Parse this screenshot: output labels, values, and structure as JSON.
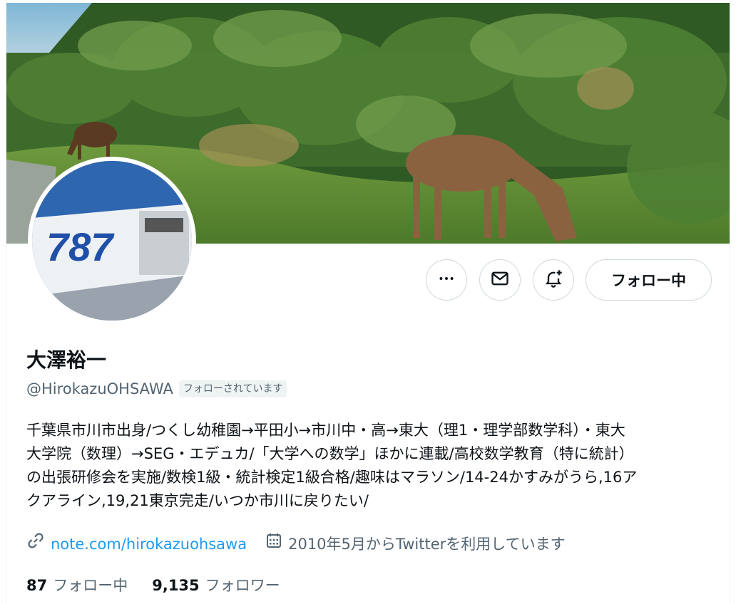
{
  "profile": {
    "display_name": "大澤裕一",
    "handle": "@HirokazuOHSAWA",
    "follows_you_badge": "フォローされています",
    "bio_lines": [
      "千葉県市川市出身/つくし幼稚園→平田小→市川中・高→東大（理1・理学部数学科）・東大",
      "大学院（数理）→SEG・エデュカ/「大学への数学」ほかに連載/高校数学教育（特に統計）",
      "の出張研修会を実施/数検1級・統計検定1級合格/趣味はマラソン/14-24かすみがうら,16ア",
      "クアライン,19,21東京完走/いつか市川に戻りたい/"
    ],
    "website": "note.com/hirokazuohsawa",
    "joined": "2010年5月からTwitterを利用しています",
    "following_count": "87",
    "following_label": "フォロー中",
    "followers_count": "9,135",
    "followers_label": "フォロワー",
    "avatar_text": "787"
  },
  "actions": {
    "more_icon": "more-horizontal-icon",
    "mail_icon": "envelope-icon",
    "notify_icon": "bell-plus-icon",
    "follow_label": "フォロー中"
  },
  "colors": {
    "accent": "#1d9bf0",
    "secondary_text": "#536471",
    "border": "#cfd9de"
  }
}
